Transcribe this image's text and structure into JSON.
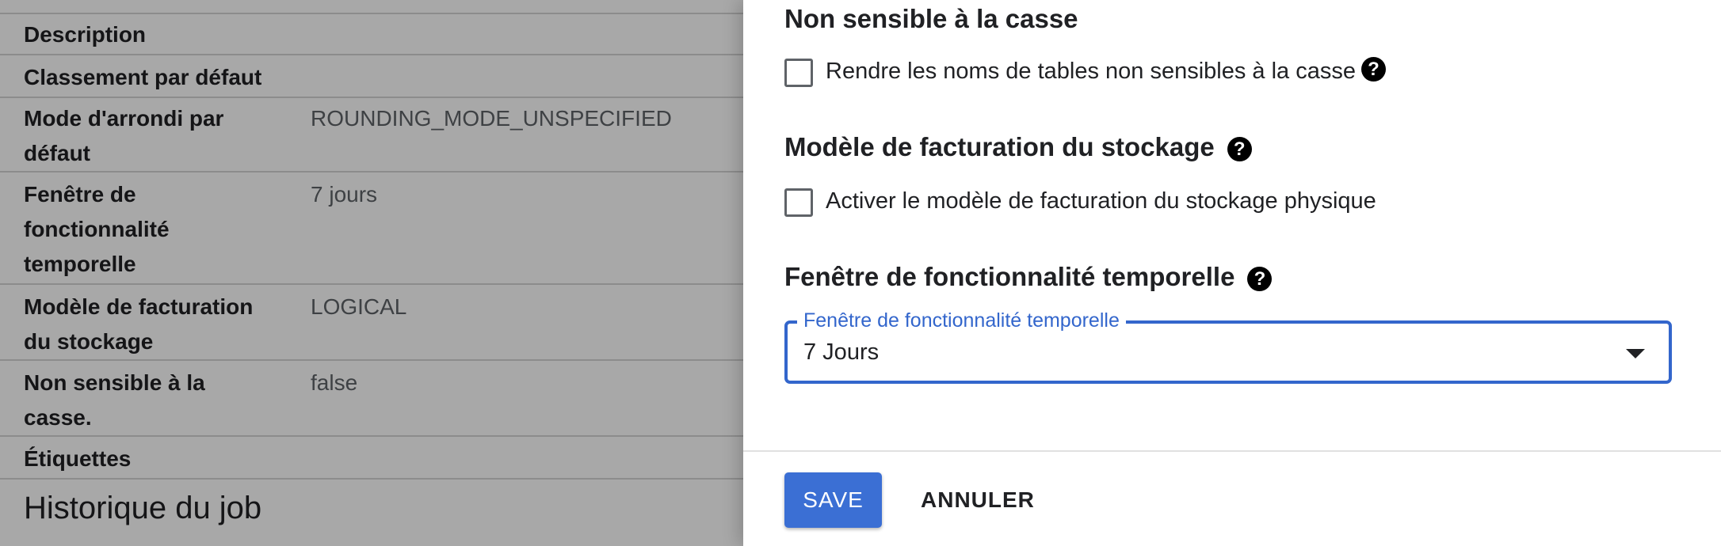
{
  "background": {
    "properties": [
      {
        "label": "Description",
        "value": ""
      },
      {
        "label": "Classement par défaut",
        "value": ""
      },
      {
        "label": "Mode d'arrondi par défaut",
        "value": "ROUNDING_MODE_UNSPECIFIED"
      },
      {
        "label": "Fenêtre de fonctionnalité temporelle",
        "value": "7 jours"
      },
      {
        "label": "Modèle de facturation du stockage",
        "value": "LOGICAL"
      },
      {
        "label": "Non sensible à la casse.",
        "value": "false"
      },
      {
        "label": "Étiquettes",
        "value": ""
      }
    ],
    "section_title": "Historique du job"
  },
  "drawer": {
    "case_section": {
      "heading": "Non sensible à la casse",
      "checkbox_label": "Rendre les noms de tables non sensibles à la casse",
      "checked": false
    },
    "billing_section": {
      "heading": "Modèle de facturation du stockage",
      "checkbox_label": "Activer le modèle de facturation du stockage physique",
      "checked": false
    },
    "time_travel_section": {
      "heading": "Fenêtre de fonctionnalité temporelle",
      "select_label": "Fenêtre de fonctionnalité temporelle",
      "select_value": "7 Jours"
    },
    "help_glyph": "?",
    "icons": [
      "help-icon",
      "chevron-down-icon"
    ],
    "accent_color": "#3366cc",
    "save_label": "SAVE",
    "cancel_label": "ANNULER"
  }
}
